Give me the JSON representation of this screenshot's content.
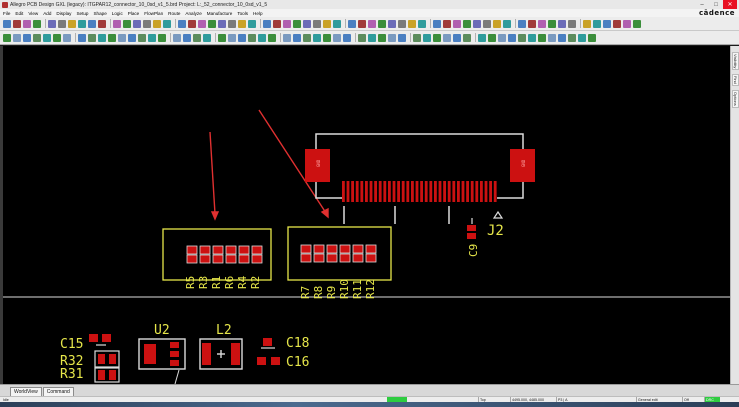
{
  "window": {
    "title": "Allegro PCB Design GXL (legacy): ITGPAR12_connector_10_0sd_v1_5.brd  Project: L:_52_connector_10_0sd_v1_5",
    "minimize": "–",
    "maximize": "□",
    "close": "✕"
  },
  "menu": {
    "items": [
      "File",
      "Edit",
      "View",
      "Add",
      "Display",
      "Setup",
      "Shape",
      "Logic",
      "Place",
      "FlowPlan",
      "Route",
      "Analyze",
      "Manufacture",
      "Tools",
      "Help"
    ],
    "brand": "cādence"
  },
  "colors": {
    "pad": "#cc1111",
    "silkscreen": "#e6e64a",
    "outline": "#dcdcdc",
    "annotation_arrow": "#e03030",
    "canvas": "#000000"
  },
  "side_tabs": [
    "Visibility",
    "Find",
    "Options"
  ],
  "components": {
    "connector": {
      "label": "J2",
      "pad_label_left": "GND",
      "pad_label_right": "GND"
    },
    "cap_c9": "C9",
    "group_left": [
      "R5",
      "R3",
      "R1",
      "R6",
      "R4",
      "R2"
    ],
    "group_right": [
      "R7",
      "R8",
      "R9",
      "R10",
      "R11",
      "R12"
    ],
    "lower": {
      "c15": "C15",
      "r32": "R32",
      "r31": "R31",
      "u2": "U2",
      "l2": "L2",
      "c18": "C18",
      "c16": "C16"
    }
  },
  "bottom_tabs": [
    "WorldView",
    "Command"
  ],
  "status": {
    "mode": "Idle",
    "layer": "Top",
    "coords": "4495.000, 4485.000",
    "units": "P3 | A",
    "edit_mode": "General edit",
    "off": "Off",
    "drc": "DRC"
  }
}
